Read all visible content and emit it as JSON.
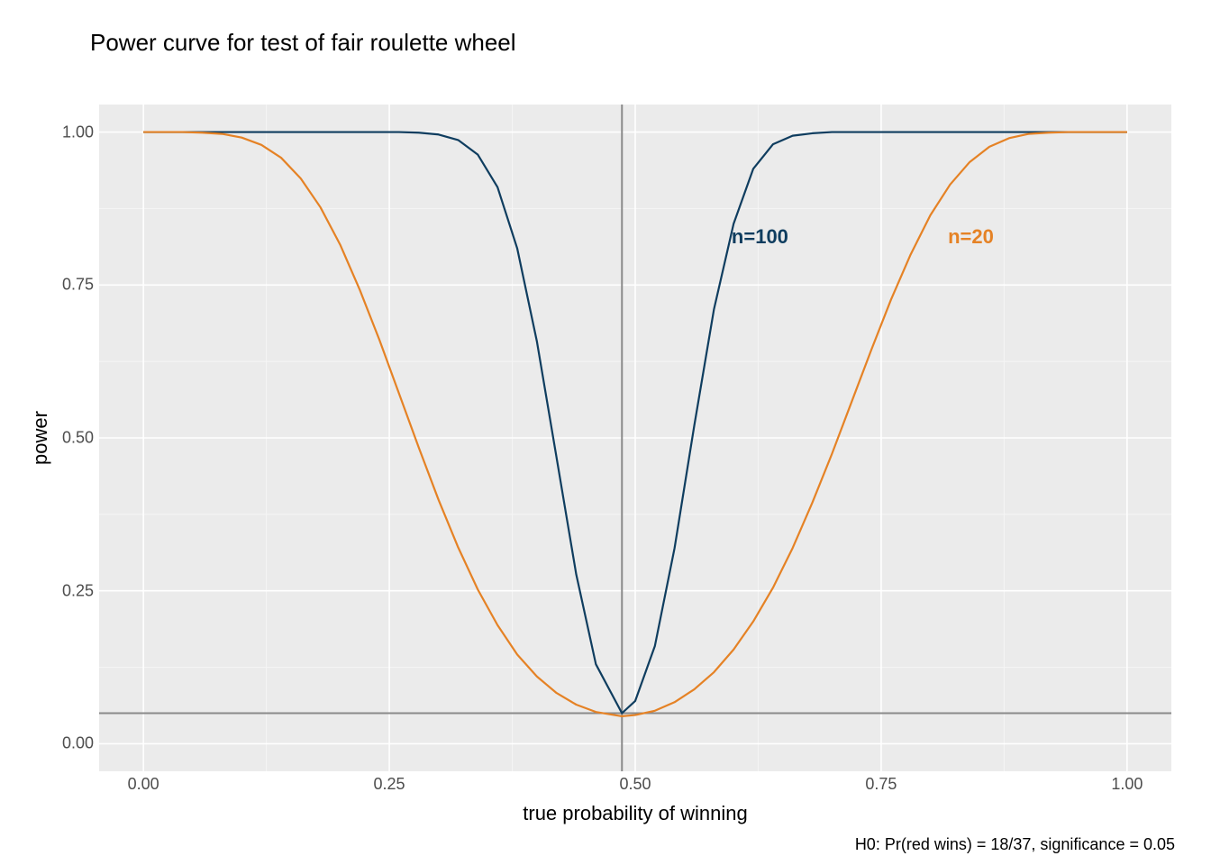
{
  "chart_data": {
    "type": "line",
    "title": "Power curve for test of fair roulette wheel",
    "xlabel": "true probability of winning",
    "ylabel": "power",
    "caption": "H0: Pr(red wins) = 18/37, significance = 0.05",
    "xlim": [
      0,
      1
    ],
    "ylim": [
      0,
      1
    ],
    "x_ticks": [
      0.0,
      0.25,
      0.5,
      0.75,
      1.0
    ],
    "y_ticks": [
      0.0,
      0.25,
      0.5,
      0.75,
      1.0
    ],
    "h0_probability": 0.4865,
    "significance": 0.05,
    "vline_x": 0.4865,
    "hline_y": 0.05,
    "series_labels": [
      {
        "name": "n=100",
        "color": "#0f3d5f",
        "x": 0.63,
        "y": 0.83
      },
      {
        "name": "n=20",
        "color": "#e58225",
        "x": 0.85,
        "y": 0.83
      }
    ],
    "series": [
      {
        "name": "n=100",
        "color": "#0f3d5f",
        "x": [
          0.0,
          0.02,
          0.04,
          0.06,
          0.08,
          0.1,
          0.12,
          0.14,
          0.16,
          0.18,
          0.2,
          0.22,
          0.24,
          0.26,
          0.28,
          0.3,
          0.32,
          0.34,
          0.36,
          0.38,
          0.4,
          0.42,
          0.44,
          0.46,
          0.4865,
          0.5,
          0.52,
          0.54,
          0.56,
          0.58,
          0.6,
          0.62,
          0.64,
          0.66,
          0.68,
          0.7,
          0.72,
          0.74,
          0.76,
          0.78,
          0.8,
          0.82,
          0.84,
          0.86,
          0.88,
          0.9,
          0.92,
          0.94,
          0.96,
          0.98,
          1.0
        ],
        "y": [
          1.0,
          1.0,
          1.0,
          1.0,
          1.0,
          1.0,
          1.0,
          1.0,
          1.0,
          1.0,
          1.0,
          1.0,
          1.0,
          1.0,
          0.999,
          0.996,
          0.987,
          0.963,
          0.91,
          0.81,
          0.658,
          0.468,
          0.277,
          0.13,
          0.05,
          0.07,
          0.16,
          0.32,
          0.52,
          0.71,
          0.85,
          0.94,
          0.98,
          0.994,
          0.998,
          1.0,
          1.0,
          1.0,
          1.0,
          1.0,
          1.0,
          1.0,
          1.0,
          1.0,
          1.0,
          1.0,
          1.0,
          1.0,
          1.0,
          1.0,
          1.0
        ]
      },
      {
        "name": "n=20",
        "color": "#e58225",
        "x": [
          0.0,
          0.02,
          0.04,
          0.06,
          0.08,
          0.1,
          0.12,
          0.14,
          0.16,
          0.18,
          0.2,
          0.22,
          0.24,
          0.26,
          0.28,
          0.3,
          0.32,
          0.34,
          0.36,
          0.38,
          0.4,
          0.42,
          0.44,
          0.46,
          0.4865,
          0.5,
          0.52,
          0.54,
          0.56,
          0.58,
          0.6,
          0.62,
          0.64,
          0.66,
          0.68,
          0.7,
          0.72,
          0.74,
          0.76,
          0.78,
          0.8,
          0.82,
          0.84,
          0.86,
          0.88,
          0.9,
          0.92,
          0.94,
          0.96,
          0.98,
          1.0
        ],
        "y": [
          1.0,
          1.0,
          1.0,
          0.999,
          0.997,
          0.991,
          0.979,
          0.958,
          0.924,
          0.877,
          0.816,
          0.742,
          0.66,
          0.572,
          0.484,
          0.399,
          0.321,
          0.252,
          0.194,
          0.146,
          0.11,
          0.083,
          0.064,
          0.052,
          0.045,
          0.047,
          0.054,
          0.068,
          0.089,
          0.117,
          0.154,
          0.2,
          0.255,
          0.32,
          0.394,
          0.474,
          0.559,
          0.644,
          0.726,
          0.8,
          0.864,
          0.914,
          0.951,
          0.976,
          0.99,
          0.997,
          0.999,
          1.0,
          1.0,
          1.0,
          1.0
        ]
      }
    ]
  }
}
